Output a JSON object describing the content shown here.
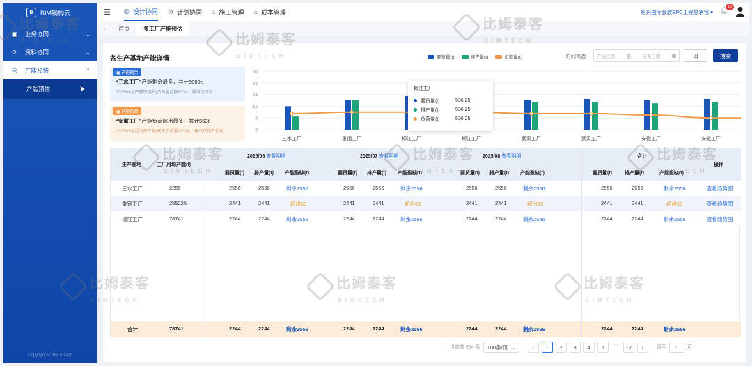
{
  "sidebar": {
    "brand": "BIM钢构云",
    "items": [
      {
        "label": "业务协同",
        "icon": "briefcase-icon"
      },
      {
        "label": "资料协同",
        "icon": "folder-sync-icon"
      },
      {
        "label": "产能预估",
        "icon": "gauge-icon"
      }
    ],
    "sub_item": "产能预估",
    "copyright": "Copyright © BIM Fusion"
  },
  "topbar": {
    "modules": [
      "设计协同",
      "计划协同",
      "施工管理",
      "成本管理"
    ],
    "project": "绍兴国际会展EPC工程总承包",
    "notification_count": "16"
  },
  "tabs": [
    "首页",
    "多工厂产能预估"
  ],
  "panel": {
    "title": "各生产基地产能详情",
    "legend": [
      "要货量(t)",
      "排产量(t)",
      "负荷量(t)"
    ],
    "filter_label": "时间筛选:",
    "date_start_placeholder": "开始日期",
    "date_sep": "至",
    "date_end_placeholder": "结束日期",
    "search_label": "搜索"
  },
  "cards": {
    "surplus": {
      "tag": "产能剩余",
      "highlight": "“三水工厂”",
      "text": "产能剩余最多，共计5000t;",
      "sub": "2025/06月产能不饱和(负荷量超额80%)，需增加订单"
    },
    "overload": {
      "tag": "产能负荷",
      "highlight": "“安徽工厂”",
      "text": "产能负荷超出最多，共计563t;",
      "sub": "2025/06月超负荷产能(高于负荷量120%)，建议将排产优化"
    }
  },
  "chart_data": {
    "type": "bar",
    "categories": [
      "三水工厂",
      "重钢工厂",
      "柳江工厂",
      "柳江工厂",
      "武汉工厂",
      "武汉工厂",
      "安徽工厂",
      "安徽工厂"
    ],
    "y_ticks": [
      "0",
      "8",
      "16",
      "24",
      "32",
      "50"
    ],
    "series": [
      {
        "name": "要货量(t)",
        "color": "#1a56b8",
        "values": [
          16,
          20,
          23,
          21,
          20,
          21,
          20,
          21
        ]
      },
      {
        "name": "排产量(t)",
        "color": "#1fa37a",
        "values": [
          9,
          20,
          21,
          19,
          19,
          19,
          18,
          19
        ]
      },
      {
        "name": "负荷量(t)",
        "color": "#ef9a4a",
        "type": "line",
        "values": [
          11,
          12,
          12,
          12,
          11,
          11,
          10,
          8
        ]
      }
    ],
    "grid": true
  },
  "tooltip": {
    "title": "柳江工厂",
    "rows": [
      {
        "label": "要货量(t)",
        "value": "536.25",
        "color": "#1a56b8"
      },
      {
        "label": "排产量(t)",
        "value": "536.25",
        "color": "#1fa37a"
      },
      {
        "label": "负荷量(t)",
        "value": "536.25",
        "color": "#ef9a4a"
      }
    ]
  },
  "table": {
    "base_col": "生产基地",
    "cap_col": "工厂月均产能(t)",
    "periods": [
      {
        "label": "2025/06",
        "link": "查看明细"
      },
      {
        "label": "2025/07",
        "link": "查看明细"
      },
      {
        "label": "2025/08",
        "link": "查看明细"
      }
    ],
    "sub_cols": [
      "要货量(t)",
      "排产量(t)",
      "产能盈缺(t)"
    ],
    "total_group": "合计",
    "action_col": "操作",
    "rows": [
      {
        "name": "三水工厂",
        "cap": "2255",
        "p": [
          [
            "2556",
            "2556",
            "剩余2556"
          ],
          [
            "2556",
            "2556",
            "剩余2556"
          ],
          [
            "2556",
            "2556",
            "剩余2556"
          ]
        ],
        "t": [
          "2556",
          "2556",
          "剩余2556"
        ],
        "action": "查看趋势图"
      },
      {
        "name": "重钢工厂",
        "cap": "255225",
        "p": [
          [
            "2441",
            "2441",
            "超出50"
          ],
          [
            "2441",
            "2441",
            "超出50"
          ],
          [
            "2441",
            "2441",
            "超出50"
          ]
        ],
        "t": [
          "2441",
          "2441",
          "超出50"
        ],
        "action": "查看趋势图"
      },
      {
        "name": "柳江工厂",
        "cap": "78741",
        "p": [
          [
            "2244",
            "2244",
            "剩余2556"
          ],
          [
            "2244",
            "2244",
            "剩余2556"
          ],
          [
            "2244",
            "2244",
            "剩余2556"
          ]
        ],
        "t": [
          "2244",
          "2244",
          "剩余2556"
        ],
        "action": "查看趋势图"
      }
    ],
    "total": {
      "label": "合计",
      "cap": "78741",
      "p": [
        [
          "2244",
          "2244",
          "剩余2556"
        ],
        [
          "2244",
          "2244",
          "剩余2556"
        ],
        [
          "2244",
          "2244",
          "剩余2556"
        ]
      ],
      "t": [
        "2244",
        "2244",
        "剩余2556"
      ]
    }
  },
  "pagination": {
    "total_text": "当前共 964 条",
    "page_size": "100条/页",
    "pages": [
      "1",
      "2",
      "3",
      "4",
      "5",
      "…",
      "12"
    ],
    "current": "1",
    "goto_label": "跳至",
    "goto_value": "1",
    "page_suffix": "页"
  },
  "watermark": {
    "cn": "比姆泰客",
    "en": "BIMTECH"
  }
}
